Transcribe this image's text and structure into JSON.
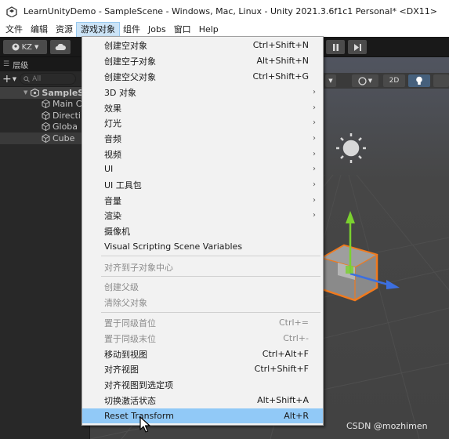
{
  "window": {
    "title": "LearnUnityDemo - SampleScene - Windows, Mac, Linux - Unity 2021.3.6f1c1 Personal* <DX11>"
  },
  "menubar": {
    "items": [
      "文件",
      "编辑",
      "资源",
      "游戏对象",
      "组件",
      "Jobs",
      "窗口",
      "Help"
    ],
    "active": "游戏对象"
  },
  "toolbar": {
    "account_label": "KZ"
  },
  "hierarchy": {
    "tab_label": "层级",
    "search_placeholder": "All",
    "scene_name": "SampleS",
    "objects": [
      "Main C",
      "Directi",
      "Globa",
      "Cube"
    ]
  },
  "scene_toolbar": {
    "mode_2d": "2D"
  },
  "game_object_menu": {
    "items": [
      {
        "label": "创建空对象",
        "shortcut": "Ctrl+Shift+N",
        "submenu": false,
        "enabled": true
      },
      {
        "label": "创建空子对象",
        "shortcut": "Alt+Shift+N",
        "submenu": false,
        "enabled": true
      },
      {
        "label": "创建空父对象",
        "shortcut": "Ctrl+Shift+G",
        "submenu": false,
        "enabled": true
      },
      {
        "label": "3D 对象",
        "shortcut": "",
        "submenu": true,
        "enabled": true
      },
      {
        "label": "效果",
        "shortcut": "",
        "submenu": true,
        "enabled": true
      },
      {
        "label": "灯光",
        "shortcut": "",
        "submenu": true,
        "enabled": true
      },
      {
        "label": "音频",
        "shortcut": "",
        "submenu": true,
        "enabled": true
      },
      {
        "label": "视频",
        "shortcut": "",
        "submenu": true,
        "enabled": true
      },
      {
        "label": "UI",
        "shortcut": "",
        "submenu": true,
        "enabled": true
      },
      {
        "label": "UI 工具包",
        "shortcut": "",
        "submenu": true,
        "enabled": true
      },
      {
        "label": "音量",
        "shortcut": "",
        "submenu": true,
        "enabled": true
      },
      {
        "label": "渲染",
        "shortcut": "",
        "submenu": true,
        "enabled": true
      },
      {
        "label": "摄像机",
        "shortcut": "",
        "submenu": false,
        "enabled": true
      },
      {
        "label": "Visual Scripting Scene Variables",
        "shortcut": "",
        "submenu": false,
        "enabled": true
      },
      {
        "label": "对齐到子对象中心",
        "shortcut": "",
        "submenu": false,
        "enabled": false
      },
      {
        "label": "创建父级",
        "shortcut": "",
        "submenu": false,
        "enabled": false
      },
      {
        "label": "清除父对象",
        "shortcut": "",
        "submenu": false,
        "enabled": false
      },
      {
        "label": "置于同级首位",
        "shortcut": "Ctrl+=",
        "submenu": false,
        "enabled": false
      },
      {
        "label": "置于同级末位",
        "shortcut": "Ctrl+-",
        "submenu": false,
        "enabled": false
      },
      {
        "label": "移动到视图",
        "shortcut": "Ctrl+Alt+F",
        "submenu": false,
        "enabled": true
      },
      {
        "label": "对齐视图",
        "shortcut": "Ctrl+Shift+F",
        "submenu": false,
        "enabled": true
      },
      {
        "label": "对齐视图到选定项",
        "shortcut": "",
        "submenu": false,
        "enabled": true
      },
      {
        "label": "切换激活状态",
        "shortcut": "Alt+Shift+A",
        "submenu": false,
        "enabled": true
      },
      {
        "label": "Reset Transform",
        "shortcut": "Alt+R",
        "submenu": false,
        "enabled": true,
        "highlighted": true
      }
    ]
  },
  "watermark": "CSDN @mozhimen"
}
